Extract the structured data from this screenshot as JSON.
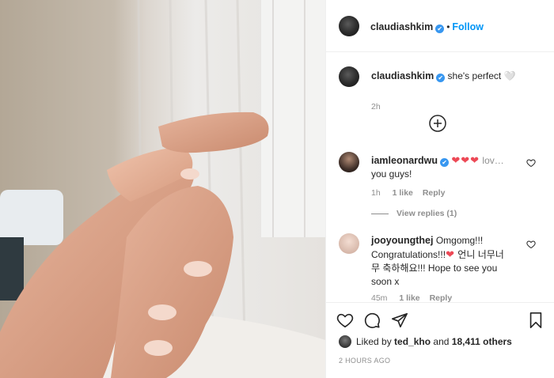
{
  "post": {
    "author": "claudiashkim",
    "verified_mark": "✔",
    "separator": "•",
    "follow_label": "Follow",
    "caption": "she's perfect 🤍",
    "caption_age": "2h"
  },
  "comments": [
    {
      "user": "iamleonardwu",
      "hearts": "❤❤❤",
      "text": "lov…",
      "text_line2": "you guys!",
      "age": "1h",
      "likes": "1 like",
      "reply_label": "Reply",
      "view_replies": "View replies (1)"
    },
    {
      "user": "jooyoungthej",
      "text_line1": "Omgomg!!!",
      "text_line2_a": "Congratulations!!!",
      "heart": "❤",
      "text_line2_b": " 언니 너무너",
      "text_line3": "무 축하해요!!! Hope to see you",
      "text_line4": "soon x",
      "age": "45m",
      "likes": "1 like",
      "reply_label": "Reply"
    }
  ],
  "footer": {
    "liked_prefix": "Liked by",
    "liked_user": "ted_kho",
    "liked_and": "and",
    "liked_count": "18,411 others",
    "timestamp": "2 HOURS AGO"
  },
  "icons": {
    "heart": "heart-icon",
    "comment": "comment-icon",
    "share": "share-icon",
    "save": "bookmark-icon",
    "add_comment": "plus-circle-icon"
  },
  "colors": {
    "accent_blue": "#0095f6",
    "verified_blue": "#3897f0",
    "heart_red": "#ed4956",
    "muted_text": "#8e8e8e"
  }
}
